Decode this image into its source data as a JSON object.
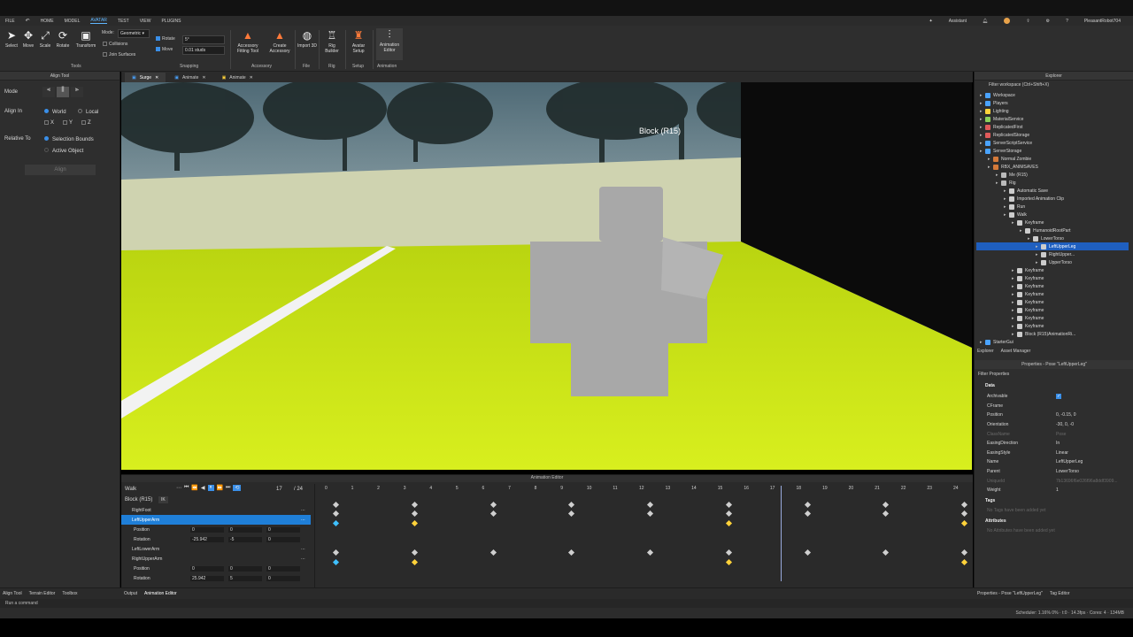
{
  "menubar": {
    "items": [
      "FILE",
      "HOME",
      "MODEL",
      "AVATAR",
      "TEST",
      "VIEW",
      "PLUGINS"
    ],
    "active": "AVATAR",
    "assistant": "Assistant",
    "username": "PleasantRobot704"
  },
  "ribbon": {
    "tools": [
      {
        "label": "Select",
        "icon": "cursor-icon"
      },
      {
        "label": "Move",
        "icon": "move-icon"
      },
      {
        "label": "Scale",
        "icon": "scale-icon"
      },
      {
        "label": "Rotate",
        "icon": "rotate-icon"
      },
      {
        "label": "Transform",
        "icon": "transform-icon"
      }
    ],
    "tools_group": "Tools",
    "mode_label": "Mode:",
    "mode_value": "Geometric",
    "collisions": "Collisions",
    "join_surfaces": "Join Surfaces",
    "rotate_label": "Rotate",
    "rotate_value": "5°",
    "move_label": "Move",
    "move_value": "0.01 studs",
    "snapping_group": "Snapping",
    "accessory_fitting": "Accessory Fitting Tool",
    "create_accessory": "Create Accessory",
    "accessory_group": "Accessory",
    "import3d": "Import 3D",
    "file_group": "File",
    "rig_builder": "Rig Builder",
    "rig_group": "Rig",
    "avatar_setup": "Avatar Setup",
    "setup_group": "Setup",
    "animation_editor": "Animation Editor",
    "animation_group": "Animation"
  },
  "align_tool": {
    "title": "Align Tool",
    "mode": "Mode",
    "align_in": "Align In",
    "world": "World",
    "local": "Local",
    "x": "X",
    "y": "Y",
    "z": "Z",
    "relative_to": "Relative To",
    "selection_bounds": "Selection Bounds",
    "active_object": "Active Object",
    "align_button": "Align"
  },
  "tabs": [
    {
      "label": "Surge",
      "active": true
    },
    {
      "label": "Animate",
      "active": false
    },
    {
      "label": "Animate",
      "active": false
    }
  ],
  "viewport": {
    "rig_label": "Block (R15)"
  },
  "animation_editor": {
    "title": "Animation Editor",
    "clip": "Walk",
    "rig": "Block (R15)",
    "ik": "IK",
    "frame": "17",
    "total": "/ 24",
    "ticks": [
      "0",
      "1",
      "2",
      "3",
      "4",
      "5",
      "6",
      "7",
      "8",
      "9",
      "10",
      "11",
      "12",
      "13",
      "14",
      "15",
      "16",
      "17",
      "18",
      "19",
      "20",
      "21",
      "22",
      "23",
      "24"
    ],
    "tracks": [
      {
        "name": "RightFoot",
        "type": "part"
      },
      {
        "name": "LeftUpperArm",
        "type": "part",
        "selected": true
      },
      {
        "name": "Position",
        "type": "prop",
        "x": "0",
        "y": "0",
        "z": "0"
      },
      {
        "name": "Rotation",
        "type": "prop",
        "x": "-25.942",
        "y": "-5",
        "z": "0"
      },
      {
        "name": "LeftLowerArm",
        "type": "part"
      },
      {
        "name": "RightUpperArm",
        "type": "part"
      },
      {
        "name": "Position",
        "type": "prop",
        "x": "0",
        "y": "0",
        "z": "0"
      },
      {
        "name": "Rotation",
        "type": "prop",
        "x": "25.942",
        "y": "5",
        "z": "0"
      }
    ]
  },
  "explorer": {
    "title": "Explorer",
    "filter": "Filter workspace (Ctrl+Shift+X)",
    "items": [
      {
        "label": "Workspace",
        "depth": 0,
        "color": "#4aa3ff"
      },
      {
        "label": "Players",
        "depth": 0,
        "color": "#4aa3ff"
      },
      {
        "label": "Lighting",
        "depth": 0,
        "color": "#ffd23a"
      },
      {
        "label": "MaterialService",
        "depth": 0,
        "color": "#8bd05a"
      },
      {
        "label": "ReplicatedFirst",
        "depth": 0,
        "color": "#e05a5a"
      },
      {
        "label": "ReplicatedStorage",
        "depth": 0,
        "color": "#e05a5a"
      },
      {
        "label": "ServerScriptService",
        "depth": 0,
        "color": "#4aa3ff"
      },
      {
        "label": "ServerStorage",
        "depth": 0,
        "color": "#4aa3ff"
      },
      {
        "label": "Normal Zombie",
        "depth": 1,
        "color": "#d47a3a"
      },
      {
        "label": "RBX_ANIMSAVES",
        "depth": 1,
        "color": "#d47a3a"
      },
      {
        "label": "Me (R15)",
        "depth": 2,
        "color": "#bbbbbb"
      },
      {
        "label": "Rig",
        "depth": 2,
        "color": "#bbbbbb"
      },
      {
        "label": "Automatic Save",
        "depth": 3,
        "color": "#cccccc"
      },
      {
        "label": "Imported Animation Clip",
        "depth": 3,
        "color": "#cccccc"
      },
      {
        "label": "Run",
        "depth": 3,
        "color": "#cccccc"
      },
      {
        "label": "Walk",
        "depth": 3,
        "color": "#cccccc"
      },
      {
        "label": "Keyframe",
        "depth": 4,
        "color": "#cccccc"
      },
      {
        "label": "HumanoidRootPart",
        "depth": 5,
        "color": "#cccccc"
      },
      {
        "label": "LowerTorso",
        "depth": 6,
        "color": "#cccccc"
      },
      {
        "label": "LeftUpperLeg",
        "depth": 7,
        "color": "#cccccc",
        "selected": true
      },
      {
        "label": "RightUpper...",
        "depth": 7,
        "color": "#cccccc"
      },
      {
        "label": "UpperTorso",
        "depth": 7,
        "color": "#cccccc"
      },
      {
        "label": "Keyframe",
        "depth": 4,
        "color": "#cccccc"
      },
      {
        "label": "Keyframe",
        "depth": 4,
        "color": "#cccccc"
      },
      {
        "label": "Keyframe",
        "depth": 4,
        "color": "#cccccc"
      },
      {
        "label": "Keyframe",
        "depth": 4,
        "color": "#cccccc"
      },
      {
        "label": "Keyframe",
        "depth": 4,
        "color": "#cccccc"
      },
      {
        "label": "Keyframe",
        "depth": 4,
        "color": "#cccccc"
      },
      {
        "label": "Keyframe",
        "depth": 4,
        "color": "#cccccc"
      },
      {
        "label": "Keyframe",
        "depth": 4,
        "color": "#cccccc"
      },
      {
        "label": "Block (R15)AnimationRi...",
        "depth": 4,
        "color": "#cccccc"
      },
      {
        "label": "StarterGui",
        "depth": 0,
        "color": "#4aa3ff"
      }
    ],
    "bottom_tabs": [
      "Explorer",
      "Asset Manager"
    ]
  },
  "properties": {
    "title": "Properties - Pose \"LeftUpperLeg\"",
    "filter": "Filter Properties",
    "data_section": "Data",
    "rows": [
      {
        "k": "Archivable",
        "v": "✓",
        "dim": false
      },
      {
        "k": "CFrame",
        "v": "",
        "dim": false
      },
      {
        "k": "Position",
        "v": "0, -0.15, 0",
        "dim": false
      },
      {
        "k": "Orientation",
        "v": "-30, 0, -0",
        "dim": false
      },
      {
        "k": "ClassName",
        "v": "Pose",
        "dim": true
      },
      {
        "k": "EasingDirection",
        "v": "In",
        "dim": false
      },
      {
        "k": "EasingStyle",
        "v": "Linear",
        "dim": false
      },
      {
        "k": "Name",
        "v": "LeftUpperLeg",
        "dim": false
      },
      {
        "k": "Parent",
        "v": "LowerTorso",
        "dim": false
      },
      {
        "k": "UniqueId",
        "v": "7b13696f6e026f96a8ddf3909...",
        "dim": true
      },
      {
        "k": "Weight",
        "v": "1",
        "dim": false
      }
    ],
    "tags_section": "Tags",
    "tags_empty": "No Tags have been added yet",
    "attributes_section": "Attributes",
    "attributes_empty": "No Attributes have been added yet"
  },
  "bottom": {
    "left_tabs": [
      "Align Tool",
      "Terrain Editor",
      "Toolbox"
    ],
    "center_tabs": [
      "Output",
      "Animation Editor"
    ],
    "right_tabs": [
      "Properties - Pose \"LeftUpperLeg\"",
      "Tag Editor"
    ],
    "command_placeholder": "Run a command",
    "status": "Scheduler: 1.16% 0% · t:0 · 14.3fps · Cores: 4 · 134MB"
  }
}
